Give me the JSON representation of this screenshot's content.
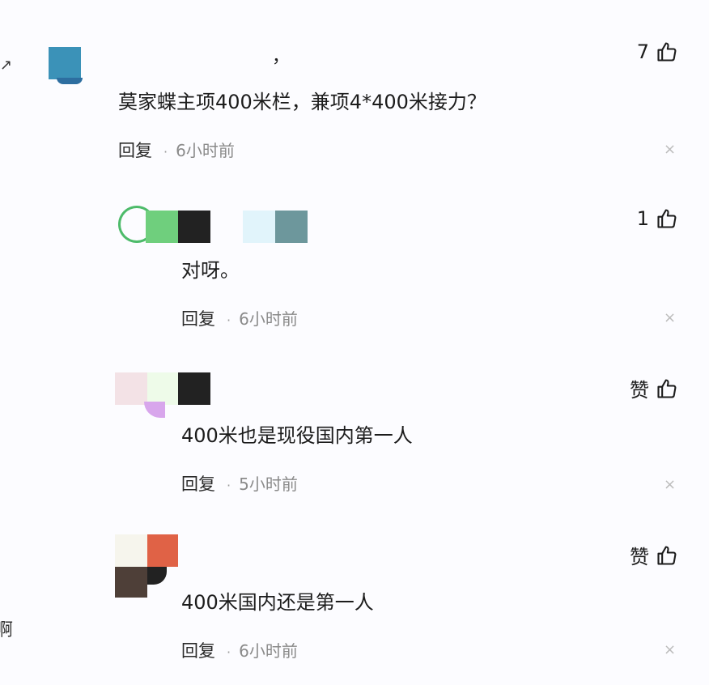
{
  "comments": [
    {
      "text": "莫家蝶主项400米栏，兼项4*400米接力？",
      "likes": "7",
      "reply_label": "回复",
      "time": "6小时前",
      "name_fragment": "，"
    },
    {
      "text": "对呀。",
      "likes": "1",
      "reply_label": "回复",
      "time": "6小时前"
    },
    {
      "text": "400米也是现役国内第一人",
      "likes": "赞",
      "reply_label": "回复",
      "time": "5小时前"
    },
    {
      "text": "400米国内还是第一人",
      "likes": "赞",
      "reply_label": "回复",
      "time": "6小时前"
    }
  ],
  "close_glyph": "×",
  "dot_glyph": "·",
  "edge_fragment": "啊",
  "icons": {
    "like": "thumbs-up-icon",
    "close": "close-icon"
  },
  "colors": {
    "text": "#1c1c1c",
    "time": "#8a8a8a",
    "close": "#bcbcbc"
  }
}
